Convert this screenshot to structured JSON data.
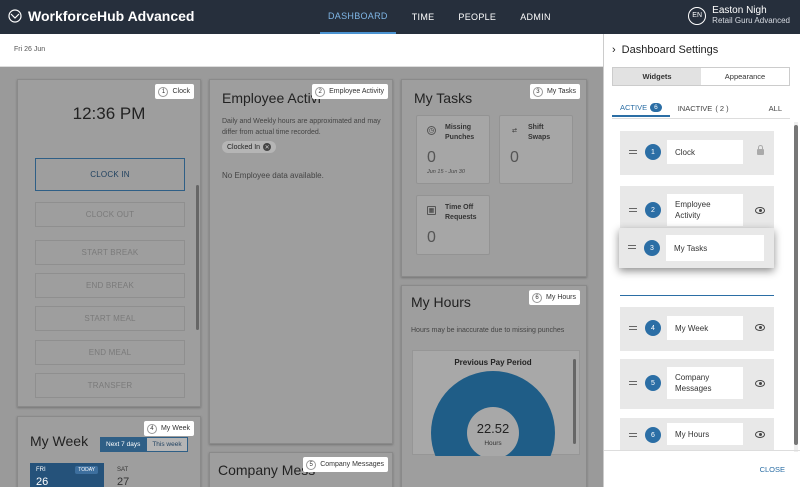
{
  "app": {
    "title": "WorkforceHub Advanced"
  },
  "nav": [
    "DASHBOARD",
    "TIME",
    "PEOPLE",
    "ADMIN"
  ],
  "user": {
    "initials": "EN",
    "name": "Easton Nigh",
    "role": "Retail Guru Advanced"
  },
  "date": "Fri 26 Jun",
  "clock": {
    "tag_num": "1",
    "tag_label": "Clock",
    "time": "12:36 PM",
    "buttons": [
      "CLOCK IN",
      "CLOCK OUT",
      "START BREAK",
      "END BREAK",
      "START MEAL",
      "END MEAL",
      "TRANSFER"
    ]
  },
  "activity": {
    "tag_num": "2",
    "tag_label": "Employee Activity",
    "title": "Employee Activi",
    "note_line1": "Daily and Weekly hours are approximated and may",
    "note_line2": "differ from actual time recorded.",
    "chip": "Clocked In",
    "empty": "No Employee data available."
  },
  "tasks": {
    "tag_num": "3",
    "tag_label": "My Tasks",
    "title": "My Tasks",
    "items": [
      {
        "label1": "Missing",
        "label2": "Punches",
        "count": "0",
        "range": "Jun 15 - Jun 30"
      },
      {
        "label1": "Shift",
        "label2": "Swaps",
        "count": "0"
      },
      {
        "label1": "Time Off",
        "label2": "Requests",
        "count": "0"
      }
    ]
  },
  "week": {
    "tag_num": "4",
    "tag_label": "My Week",
    "title": "My Week",
    "toggle_next": "Next 7 days",
    "toggle_this": "This week",
    "days": [
      {
        "name": "FRI",
        "num": "26",
        "badge": "TODAY"
      },
      {
        "name": "SAT",
        "num": "27"
      }
    ]
  },
  "messages": {
    "tag_num": "5",
    "tag_label": "Company Messages",
    "title": "Company Mess"
  },
  "hours": {
    "tag_num": "6",
    "tag_label": "My Hours",
    "title": "My Hours",
    "note": "Hours may be inaccurate due to missing punches",
    "box_title": "Previous Pay Period",
    "total": "22.52",
    "unit": "Hours"
  },
  "colors": {
    "nav_bg": "#262f3c",
    "accent": "#2b6ea5",
    "donut": "#1f5d87"
  },
  "settings": {
    "title": "Dashboard Settings",
    "tabs": [
      "Widgets",
      "Appearance"
    ],
    "filter_active": "ACTIVE",
    "active_count": "6",
    "filter_inactive": "INACTIVE",
    "inactive_count": "( 2 )",
    "filter_all": "ALL",
    "widgets": [
      {
        "num": "1",
        "name": "Clock",
        "icon": "lock-icon"
      },
      {
        "num": "2",
        "name": "Employee Activity",
        "icon": "eye-icon"
      },
      {
        "num": "4",
        "name": "My Week",
        "icon": "eye-icon"
      },
      {
        "num": "5",
        "name": "Company Messages",
        "icon": "eye-icon"
      },
      {
        "num": "6",
        "name": "My Hours",
        "icon": "eye-icon"
      }
    ],
    "dragging": {
      "num": "3",
      "name": "My Tasks"
    },
    "close": "CLOSE"
  }
}
